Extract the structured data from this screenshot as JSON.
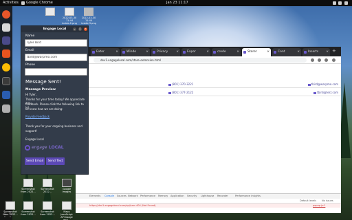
{
  "topbar": {
    "activities": "Activities",
    "app_name": "Google Chrome",
    "clock": "Jan 23  11:17"
  },
  "desktop": {
    "icons": [
      {
        "label": ""
      },
      {
        "label": "2022-03-30 11:44 inside-2.png"
      },
      {
        "label": "2022-03-30 11:44 inside-3.png"
      },
      {
        "label": "Screenshot from 2022..."
      },
      {
        "label": "Screenshot 2022..."
      },
      {
        "label": "Google Images"
      },
      {
        "label": "Screenshot from 2022..."
      },
      {
        "label": "Screenshot from 2022..."
      },
      {
        "label": "Screenshot from 2022..."
      },
      {
        "label": "Maps JavaScript API Usage and..."
      },
      {
        "label": "Google Images"
      }
    ]
  },
  "chrome": {
    "tabs": [
      {
        "label": "Exter"
      },
      {
        "label": "Windo"
      },
      {
        "label": "Privacy"
      },
      {
        "label": "Expor"
      },
      {
        "label": "crede"
      },
      {
        "label": "Storer"
      },
      {
        "label": "Cont"
      },
      {
        "label": "Inserts"
      }
    ],
    "url": "dev1.engagelocal.com/store-extension.html",
    "rows": [
      {
        "phone": "(801) 370-3221",
        "email": "tbird@warpmo.com"
      },
      {
        "phone": "(801) 377-2122",
        "email": "tbird@test.com"
      }
    ],
    "devtools": {
      "tabs": [
        "Elements",
        "Console",
        "Sources",
        "Network",
        "Performance",
        "Memory",
        "Application",
        "Security",
        "Lighthouse",
        "Recorder",
        "Performance insights"
      ],
      "filter_default": "Default levels",
      "issues": "No issues",
      "error_text": "https://dev1.engagelocal.com/api/sms 404 (Not Found)",
      "error_source": "popup.js:1"
    }
  },
  "popup": {
    "title": "Engage Local",
    "name_label": "Name",
    "name_value": "Tyler Bird",
    "email_label": "Email",
    "email_value": "tbird@warpmo.com",
    "phone_label": "Phone",
    "phone_value": "",
    "sent_msg": "Message Sent!",
    "preview_label": "Message Preview",
    "preview_line1": "Hi Tyler,",
    "preview_line2": "Thanks for your time today! We appreciate any",
    "preview_line3": "feedback. Please click the following link to let",
    "preview_line4": "us know how we are doing:",
    "preview_link": "Provide Feedback",
    "thanks_line1": "Thank you for your ongoing business and",
    "thanks_line2": "support!",
    "signature": "Engage Local",
    "logo_word1": "engage",
    "logo_word2": "LOCAL",
    "send_email_label": "Send Email",
    "send_text_label": "Send Text",
    "brand_color": "#5b48b5"
  }
}
